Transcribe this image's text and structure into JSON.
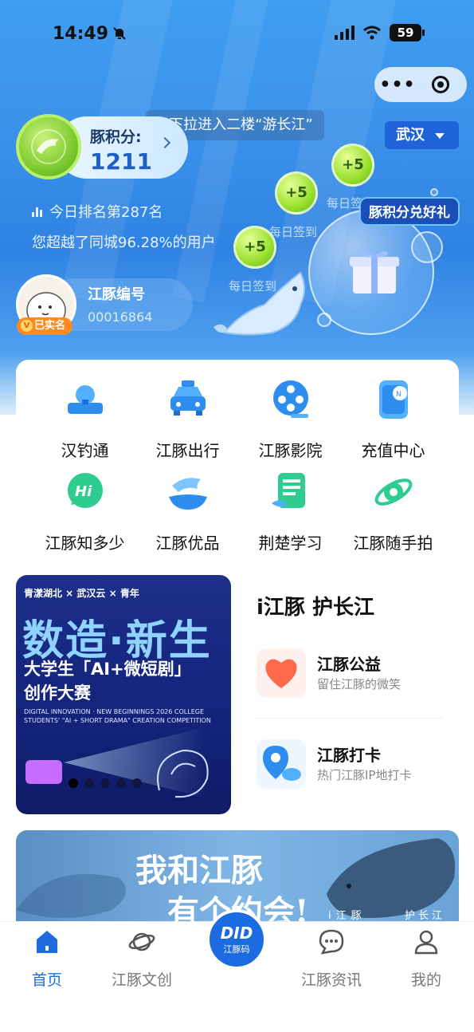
{
  "status_bar": {
    "time": "14:49",
    "battery": "59"
  },
  "header": {
    "pulldown_hint": "下拉进入二楼“游长江”",
    "city": "武汉"
  },
  "points": {
    "label": "豚积分:",
    "value": "1211",
    "rank": "今日排名第287名",
    "beat": "您超越了同城96.28%的用户"
  },
  "member": {
    "title": "江豚编号",
    "number": "00016864",
    "verified": "已实名"
  },
  "rewards": {
    "plus_label": "+5",
    "sign_label": "每日签到",
    "redeem_label": "豚积分兑好礼"
  },
  "services": [
    {
      "label": "汉钓通",
      "icon": "fishing-icon"
    },
    {
      "label": "江豚出行",
      "icon": "taxi-icon"
    },
    {
      "label": "江豚影院",
      "icon": "film-reel-icon"
    },
    {
      "label": "充值中心",
      "icon": "nfc-card-icon"
    },
    {
      "label": "江豚知多少",
      "icon": "hi-bubble-icon"
    },
    {
      "label": "江豚优品",
      "icon": "dolphin-hand-icon"
    },
    {
      "label": "荆楚学习",
      "icon": "book-icon"
    },
    {
      "label": "江豚随手拍",
      "icon": "camera-lens-icon"
    }
  ],
  "promo_banner": {
    "brands": "青漾湖北 × 武汉云 × 青年",
    "headline": "数造·新生",
    "line1": "大学生「AI+微短剧」",
    "line2": "创作大赛",
    "english": "DIGITAL INNOVATION · NEW BEGINNINGS 2026 COLLEGE STUDENTS' \"AI + SHORT DRAMA\" CREATION COMPETITION"
  },
  "protect_card": {
    "title": "i江豚 护长江",
    "items": [
      {
        "title": "江豚公益",
        "subtitle": "留住江豚的微笑",
        "icon": "heart-icon"
      },
      {
        "title": "江豚打卡",
        "subtitle": "热门江豚IP地打卡",
        "icon": "location-pin-icon"
      }
    ]
  },
  "date_banner": {
    "line1": "我和江豚",
    "line2": "有个约会!",
    "tag1": "i江豚",
    "tag2": "护长江"
  },
  "tabbar": {
    "tabs": [
      {
        "label": "首页",
        "icon": "home-icon",
        "active": true
      },
      {
        "label": "江豚文创",
        "icon": "planet-icon",
        "active": false
      },
      {
        "label": "江豚资讯",
        "icon": "chat-bubble-icon",
        "active": false
      },
      {
        "label": "我的",
        "icon": "user-icon",
        "active": false
      }
    ],
    "center": {
      "top": "DID",
      "bottom": "江豚码"
    }
  },
  "colors": {
    "accent": "#1f6ce0",
    "hero_blue": "#3c93ea",
    "points_green": "#7ecb2e"
  }
}
